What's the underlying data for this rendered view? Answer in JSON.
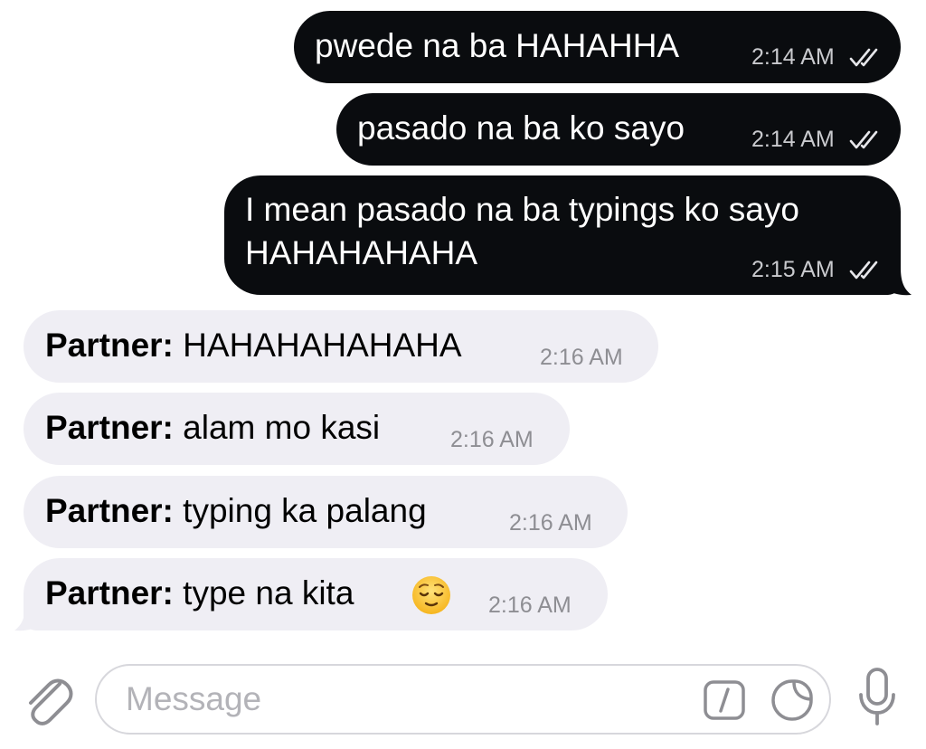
{
  "colors": {
    "outgoing_bubble": "#0a0c0f",
    "incoming_bubble": "#efeef4",
    "time_outgoing": "#c9cace",
    "time_incoming": "#8e8e93",
    "icon_gray": "#8e8e93"
  },
  "messages": [
    {
      "direction": "outgoing",
      "text": "pwede na ba HAHAHHA",
      "time": "2:14 AM",
      "status": "read-double-check-icon"
    },
    {
      "direction": "outgoing",
      "text": "pasado na ba ko sayo",
      "time": "2:14 AM",
      "status": "read-double-check-icon"
    },
    {
      "direction": "outgoing",
      "text": "I mean pasado na ba typings ko sayo HAHAHAHAHA",
      "time": "2:15 AM",
      "status": "read-double-check-icon"
    },
    {
      "direction": "incoming",
      "sender": "Partner:",
      "text": "HAHAHAHAHAHA",
      "time": "2:16 AM"
    },
    {
      "direction": "incoming",
      "sender": "Partner:",
      "text": "alam mo kasi",
      "time": "2:16 AM"
    },
    {
      "direction": "incoming",
      "sender": "Partner:",
      "text": "typing ka palang",
      "time": "2:16 AM"
    },
    {
      "direction": "incoming",
      "sender": "Partner:",
      "text": "type na kita",
      "emoji": "relieved-face-emoji",
      "time": "2:16 AM"
    }
  ],
  "input_bar": {
    "placeholder": "Message",
    "icons": [
      "paperclip-icon",
      "command-slash-icon",
      "sticker-icon",
      "microphone-icon"
    ]
  }
}
